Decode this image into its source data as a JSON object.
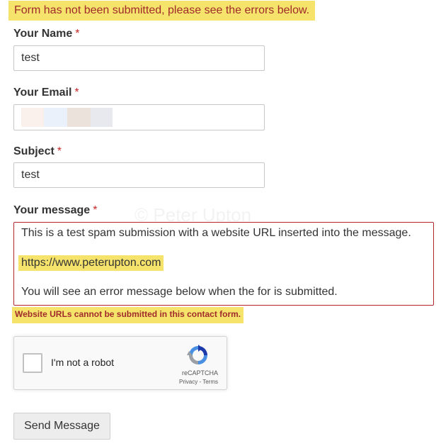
{
  "form": {
    "error_banner": "Form has not been submitted, please see the errors below.",
    "required_marker": "*",
    "name": {
      "label": "Your Name",
      "value": "test"
    },
    "email": {
      "label": "Your Email",
      "value_obscured": true
    },
    "subject": {
      "label": "Subject",
      "value": "test"
    },
    "message": {
      "label": "Your message",
      "lines": [
        "This is a test spam submission with a website URL inserted into the message.",
        "https://www.peterupton.com",
        "You will see an error message below when the for is submitted."
      ],
      "error": "Website URLs cannot be submitted in this contact form."
    },
    "watermark": "© Peter Upton",
    "recaptcha": {
      "checkbox_label": "I'm not a robot",
      "brand": "reCAPTCHA",
      "privacy": "Privacy",
      "separator": "-",
      "terms": "Terms"
    },
    "submit_label": "Send Message"
  },
  "colors": {
    "highlight": "#f5e36b",
    "error_text": "#a12b2b",
    "error_border": "#b3262b",
    "required": "#c62828"
  }
}
